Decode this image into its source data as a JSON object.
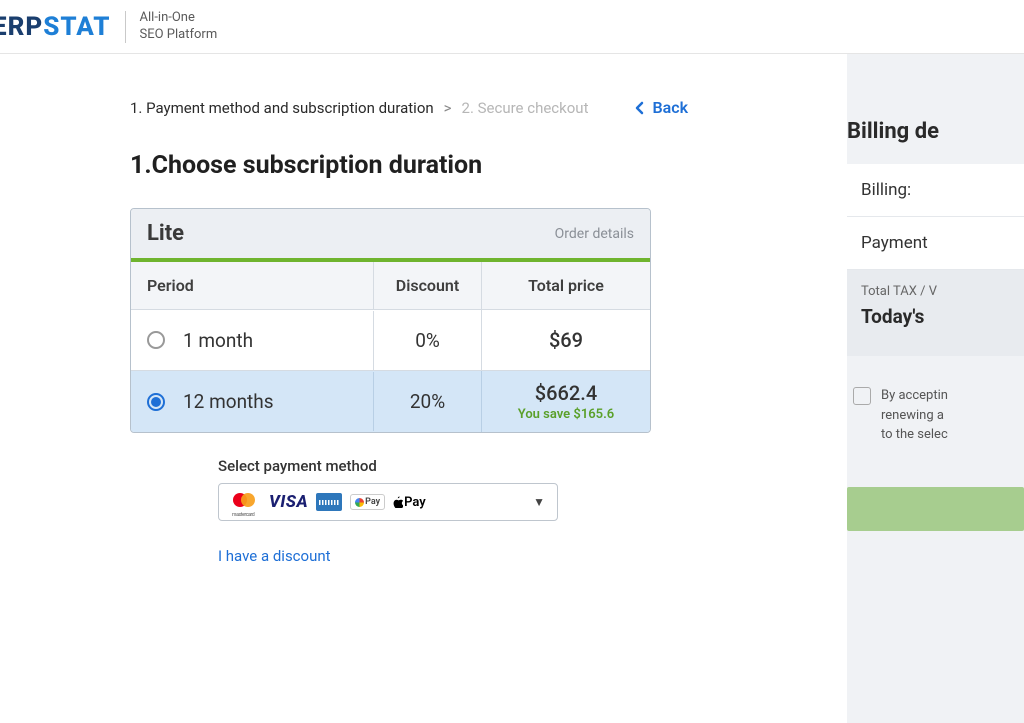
{
  "header": {
    "logo_part1": "ERP",
    "logo_part2": "STAT",
    "tagline_line1": "All-in-One",
    "tagline_line2": "SEO Platform"
  },
  "breadcrumb": {
    "step1": "1. Payment method and subscription duration",
    "separator": ">",
    "step2": "2. Secure checkout",
    "back": "Back"
  },
  "section_title": "1.Choose subscription duration",
  "plan": {
    "name": "Lite",
    "order_details": "Order details",
    "columns": {
      "period": "Period",
      "discount": "Discount",
      "price": "Total price"
    },
    "rows": [
      {
        "label": "1 month",
        "discount": "0%",
        "price": "$69",
        "save": "",
        "selected": false
      },
      {
        "label": "12 months",
        "discount": "20%",
        "price": "$662.4",
        "save": "You save $165.6",
        "selected": true
      }
    ]
  },
  "payment": {
    "label": "Select payment method",
    "discount_link": "I have a discount",
    "brands": {
      "visa": "VISA",
      "gpay": "Pay",
      "applepay": "Pay"
    }
  },
  "billing": {
    "title": "Billing de",
    "field1": "Billing:",
    "field2": "Payment",
    "tax_label": "Total TAX / V",
    "today": "Today's ",
    "terms_l1": "By acceptin",
    "terms_l2": "renewing a",
    "terms_l3": "to the selec"
  }
}
